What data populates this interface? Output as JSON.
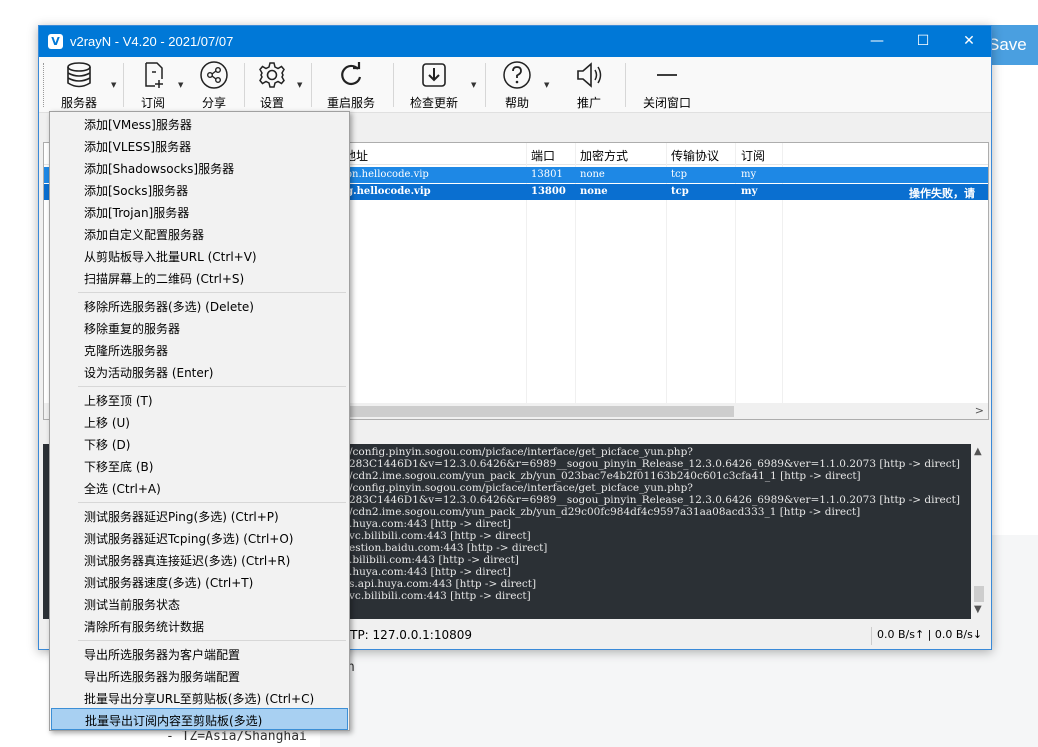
{
  "background": {
    "save_label": "Save",
    "frag_n": "n",
    "frag_tz": "- TZ=Asia/Shanghai"
  },
  "window": {
    "title": "v2rayN - V4.20 - 2021/07/07",
    "minimize": "—",
    "maximize": "☐",
    "close": "✕"
  },
  "toolbar": {
    "servers": "服务器",
    "subscription": "订阅",
    "share": "分享",
    "settings": "设置",
    "restart": "重启服务",
    "check_update": "检查更新",
    "help": "帮助",
    "promote": "推广",
    "close_window": "关闭窗口"
  },
  "grid": {
    "headers": {
      "address": "地址",
      "port": "端口",
      "encryption": "加密方式",
      "transport": "传输协议",
      "subscription": "订阅"
    },
    "rows": [
      {
        "address": "vpn.hellocode.vip",
        "port": "13801",
        "encryption": "none",
        "transport": "tcp",
        "subscription": "my",
        "extra": ""
      },
      {
        "address": "cg.hellocode.vip",
        "port": "13800",
        "encryption": "none",
        "transport": "tcp",
        "subscription": "my",
        "extra": "操作失败，请"
      }
    ]
  },
  "log": {
    "lines": [
      "/config.pinyin.sogou.com/picface/interface/get_picface_yun.php?",
      "283C1446D1&v=12.3.0.6426&r=6989__sogou_pinyin_Release_12.3.0.6426_6989&ver=1.1.0.2073 [http -> direct]",
      "/cdn2.ime.sogou.com/yun_pack_zb/yun_023bac7e4b2f01163b240c601c3cfa41_1 [http -> direct]",
      "/config.pinyin.sogou.com/picface/interface/get_picface_yun.php?",
      "283C1446D1&v=12.3.0.6426&r=6989__sogou_pinyin_Release_12.3.0.6426_6989&ver=1.1.0.2073 [http -> direct]",
      "/cdn2.ime.sogou.com/yun_pack_zb/yun_d29c00fc984df4c9597a31aa08acd333_1 [http -> direct]",
      ".huya.com:443 [http -> direct]",
      "vc.bilibili.com:443 [http -> direct]",
      "estion.baidu.com:443 [http -> direct]",
      ".bilibili.com:443 [http -> direct]",
      ".huya.com:443 [http -> direct]",
      "s.api.huya.com:443 [http -> direct]",
      "vc.bilibili.com:443 [http -> direct]"
    ]
  },
  "status": {
    "http": "TTP:  127.0.0.1:10809",
    "speed": "0.0 B/s↑ | 0.0 B/s↓"
  },
  "menu": {
    "items": [
      "添加[VMess]服务器",
      "添加[VLESS]服务器",
      "添加[Shadowsocks]服务器",
      "添加[Socks]服务器",
      "添加[Trojan]服务器",
      "添加自定义配置服务器",
      "从剪贴板导入批量URL (Ctrl+V)",
      "扫描屏幕上的二维码 (Ctrl+S)",
      "移除所选服务器(多选) (Delete)",
      "移除重复的服务器",
      "克隆所选服务器",
      "设为活动服务器 (Enter)",
      "上移至顶 (T)",
      "上移 (U)",
      "下移 (D)",
      "下移至底 (B)",
      "全选 (Ctrl+A)",
      "测试服务器延迟Ping(多选) (Ctrl+P)",
      "测试服务器延迟Tcping(多选) (Ctrl+O)",
      "测试服务器真连接延迟(多选) (Ctrl+R)",
      "测试服务器速度(多选) (Ctrl+T)",
      "测试当前服务状态",
      "清除所有服务统计数据",
      "导出所选服务器为客户端配置",
      "导出所选服务器为服务端配置",
      "批量导出分享URL至剪贴板(多选) (Ctrl+C)",
      "批量导出订阅内容至剪贴板(多选)"
    ]
  }
}
